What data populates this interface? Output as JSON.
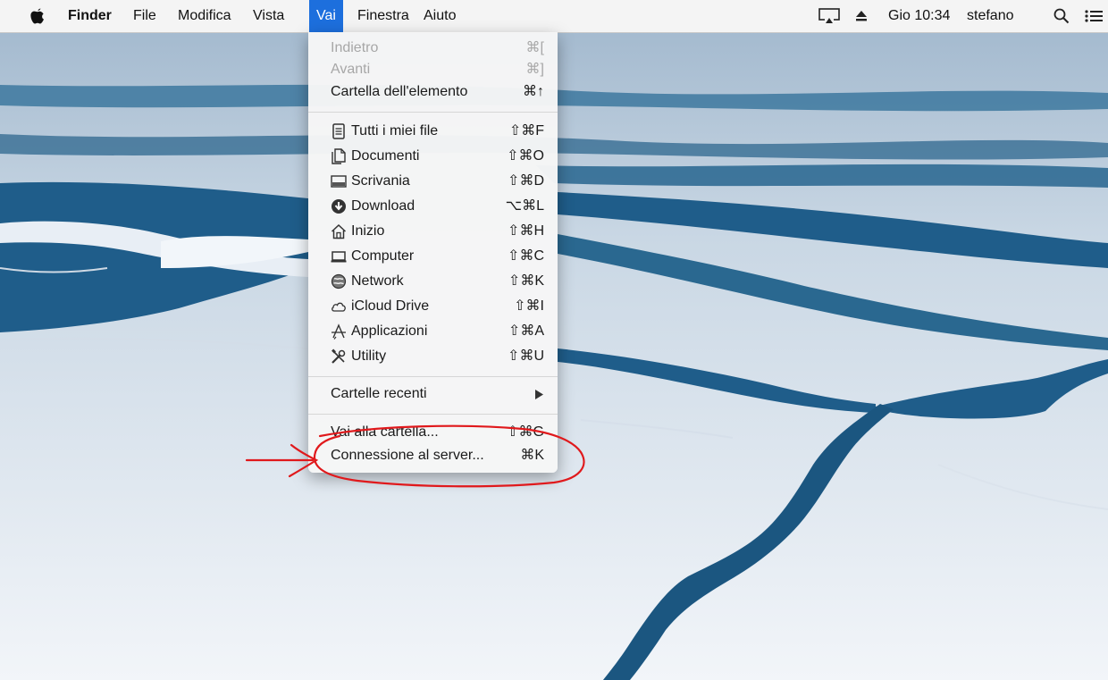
{
  "menubar": {
    "apple_icon": "apple-logo-icon",
    "items": [
      "Finder",
      "File",
      "Modifica",
      "Vista",
      "Vai",
      "Finestra",
      "Aiuto"
    ],
    "active_item": "Vai",
    "status": {
      "display_icon": "airplay-display-icon",
      "eject_icon": "eject-icon",
      "clock": "Gio 10:34",
      "user": "stefano",
      "search_icon": "spotlight-search-icon",
      "list_icon": "notification-center-icon"
    }
  },
  "menu": {
    "items": [
      {
        "label": "Indietro",
        "shortcut": "⌘[",
        "enabled": false
      },
      {
        "label": "Avanti",
        "shortcut": "⌘]",
        "enabled": false
      },
      {
        "label": "Cartella dell'elemento",
        "shortcut": "⌘↑",
        "enabled": true
      },
      {
        "label": "Tutti i miei file",
        "shortcut": "⇧⌘F",
        "icon": "all-my-files-icon"
      },
      {
        "label": "Documenti",
        "shortcut": "⇧⌘O",
        "icon": "documents-icon"
      },
      {
        "label": "Scrivania",
        "shortcut": "⇧⌘D",
        "icon": "desktop-icon"
      },
      {
        "label": "Download",
        "shortcut": "⌥⌘L",
        "icon": "download-icon"
      },
      {
        "label": "Inizio",
        "shortcut": "⇧⌘H",
        "icon": "home-icon"
      },
      {
        "label": "Computer",
        "shortcut": "⇧⌘C",
        "icon": "computer-icon"
      },
      {
        "label": "Network",
        "shortcut": "⇧⌘K",
        "icon": "network-icon"
      },
      {
        "label": "iCloud Drive",
        "shortcut": "⇧⌘I",
        "icon": "icloud-icon"
      },
      {
        "label": "Applicazioni",
        "shortcut": "⇧⌘A",
        "icon": "applications-icon"
      },
      {
        "label": "Utility",
        "shortcut": "⇧⌘U",
        "icon": "utilities-icon"
      },
      {
        "label": "Cartelle recenti",
        "submenu_icon": "submenu-arrow-icon"
      },
      {
        "label": "Vai alla cartella...",
        "shortcut": "⇧⌘G"
      },
      {
        "label": "Connessione al server...",
        "shortcut": "⌘K"
      }
    ]
  },
  "colors": {
    "menubar_bg": "#f4f4f4",
    "active_menu_bg": "#1d6fdd",
    "annotation_red": "#e0191c",
    "water": "#1f5d8a",
    "ice": "#eef2f7"
  },
  "annotation": {
    "highlighted_item": "Connessione al server...",
    "shape": "red circle and arrow"
  }
}
